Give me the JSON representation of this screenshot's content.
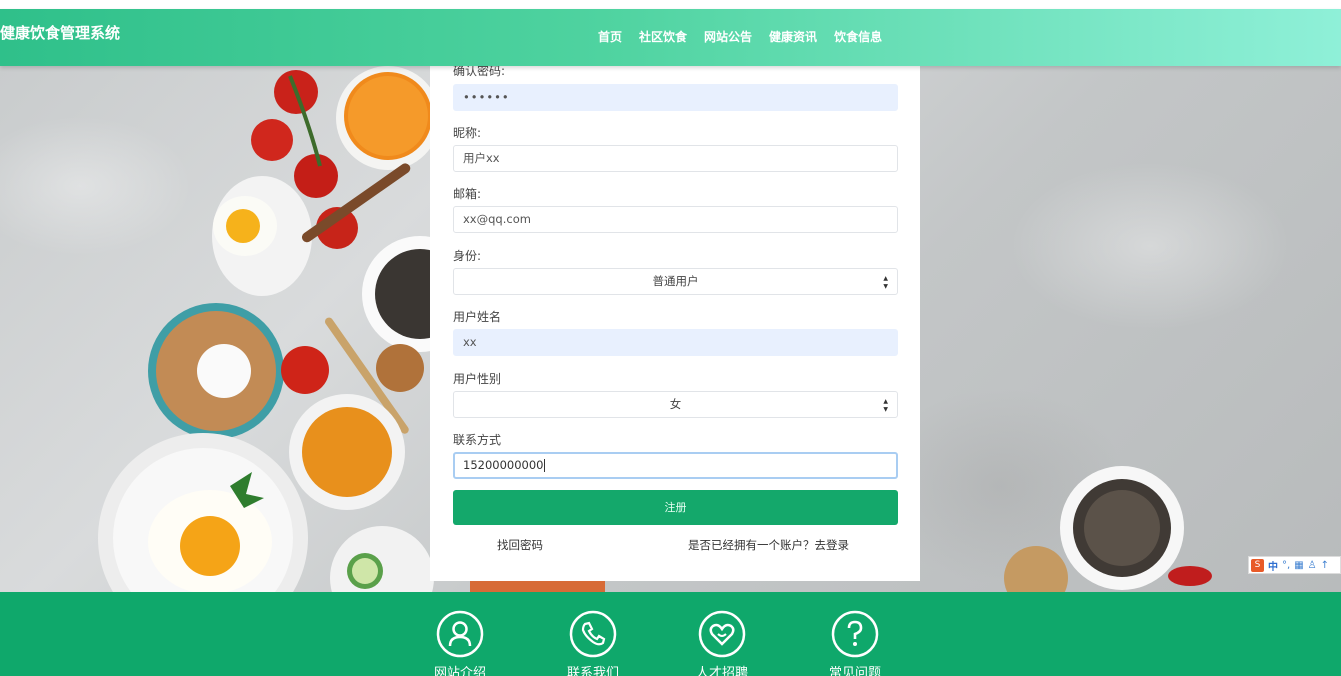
{
  "header": {
    "site_title": "健康饮食管理系统",
    "nav": [
      "首页",
      "社区饮食",
      "网站公告",
      "健康资讯",
      "饮食信息"
    ]
  },
  "form": {
    "confirm_password": {
      "label": "确认密码:",
      "value": "••••••"
    },
    "nickname": {
      "label": "昵称:",
      "placeholder": "用户xx"
    },
    "email": {
      "label": "邮箱:",
      "placeholder": "xx@qq.com"
    },
    "identity": {
      "label": "身份:",
      "value": "普通用户"
    },
    "real_name": {
      "label": "用户姓名",
      "value": "xx"
    },
    "gender": {
      "label": "用户性别",
      "value": "女"
    },
    "contact": {
      "label": "联系方式",
      "value": "15200000000"
    },
    "submit_label": "注册",
    "forgot_link": "找回密码",
    "login_link": "是否已经拥有一个账户？去登录"
  },
  "ime": {
    "logo": "S",
    "items": [
      "中",
      "°,",
      "▦",
      "♙",
      "↑"
    ]
  },
  "footer": {
    "items": [
      {
        "label": "网站介绍",
        "icon": "person-icon"
      },
      {
        "label": "联系我们",
        "icon": "phone-icon"
      },
      {
        "label": "人才招聘",
        "icon": "heart-icon"
      },
      {
        "label": "常见问题",
        "icon": "question-icon"
      }
    ]
  },
  "colors": {
    "primary": "#14a86b",
    "footer": "#0fa86b",
    "header_start": "#2fc08a",
    "header_end": "#8ff0d8"
  }
}
